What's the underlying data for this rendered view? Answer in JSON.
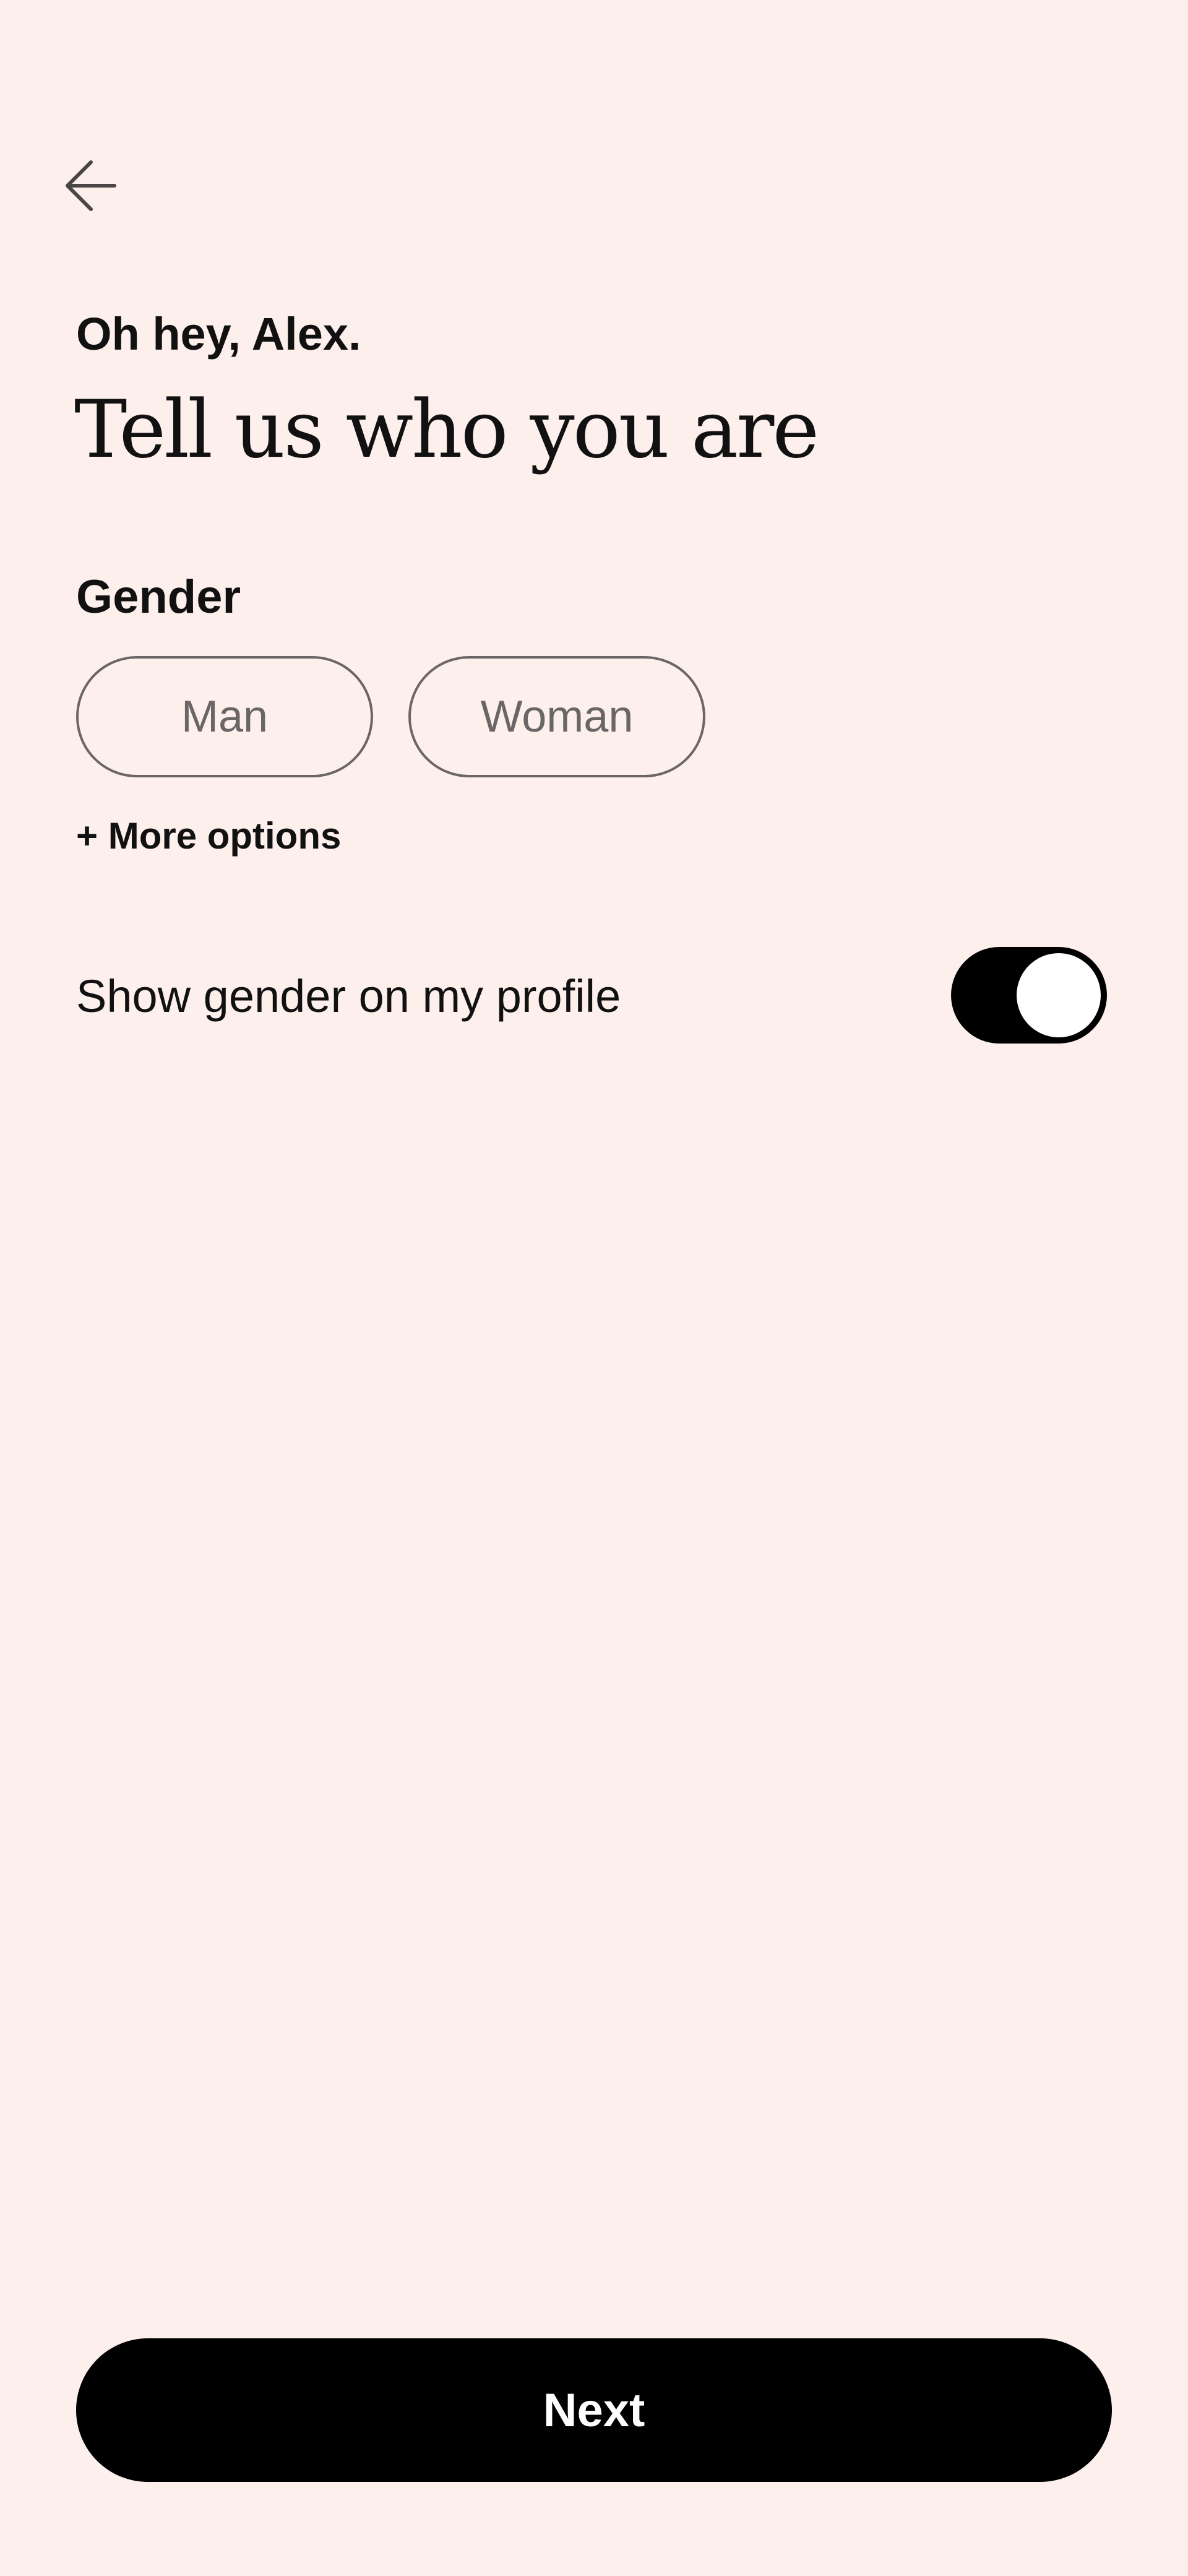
{
  "header": {
    "back_icon": "arrow-left-icon",
    "greeting": "Oh hey, Alex.",
    "title": "Tell us who you are"
  },
  "gender": {
    "label": "Gender",
    "options": [
      {
        "label": "Man",
        "selected": false
      },
      {
        "label": "Woman",
        "selected": false
      }
    ],
    "more_options": "+ More options"
  },
  "visibility": {
    "label": "Show gender on my profile",
    "toggle_on": true
  },
  "footer": {
    "next_label": "Next"
  },
  "colors": {
    "background": "#FDF0EC",
    "primary": "#000000",
    "chip_border": "#6B6665",
    "chip_text": "#6A6665"
  }
}
